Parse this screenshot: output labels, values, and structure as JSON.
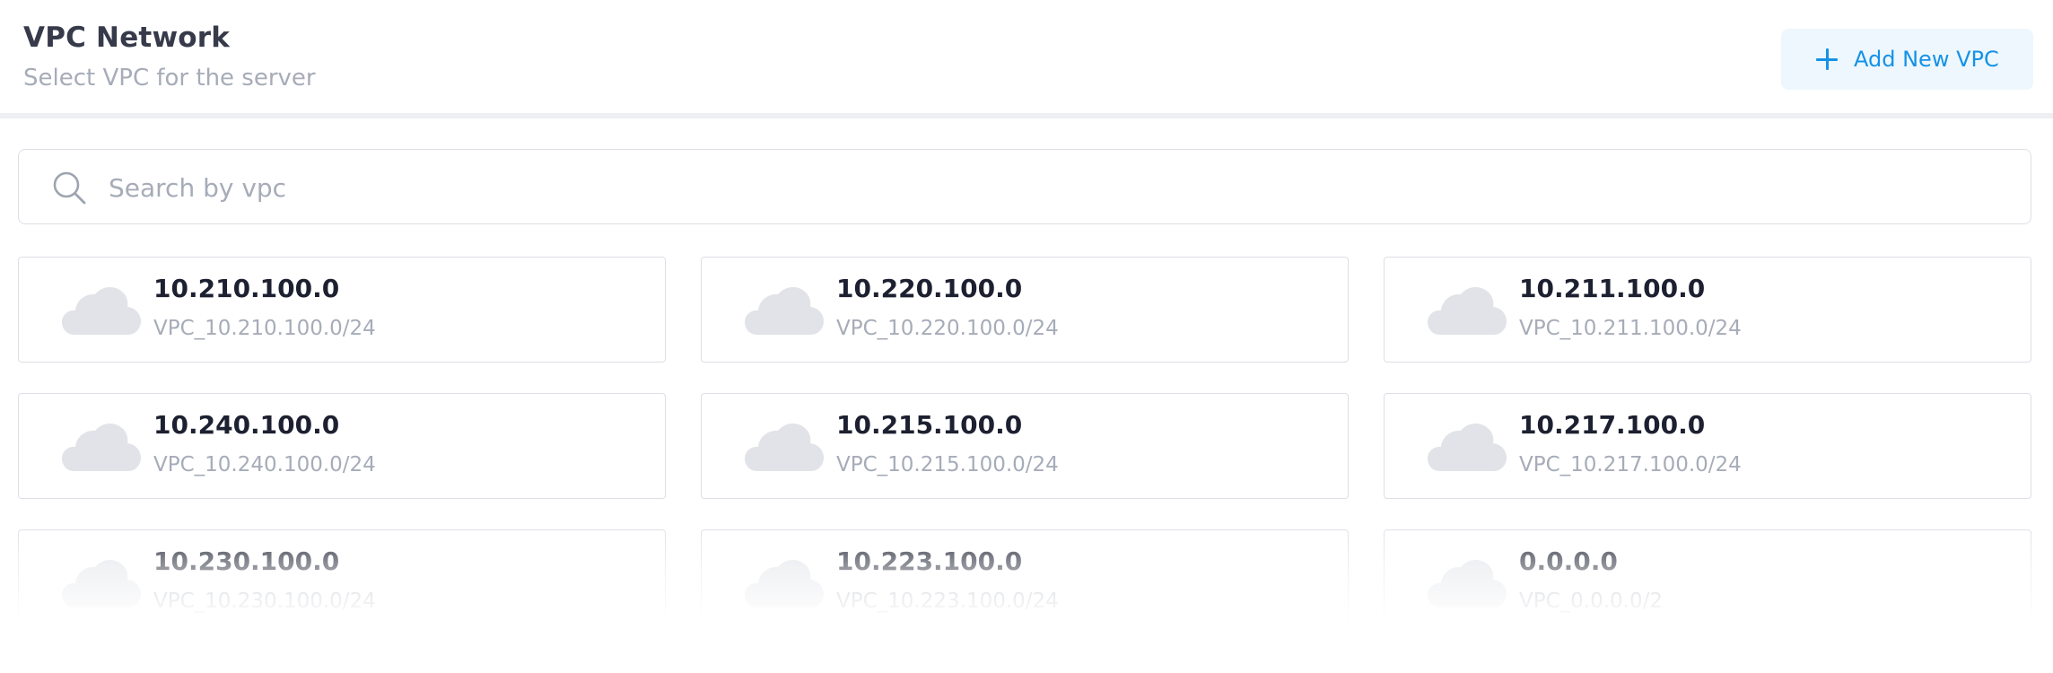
{
  "header": {
    "title": "VPC Network",
    "subtitle": "Select VPC for the server",
    "add_button_label": "Add New VPC"
  },
  "search": {
    "placeholder": "Search by vpc",
    "value": ""
  },
  "icons": {
    "add": "plus-icon",
    "search": "search-icon",
    "vpc": "cloud-icon"
  },
  "colors": {
    "accent": "#1592e6",
    "accent_bg": "#eef7fd",
    "title": "#363a4a",
    "muted": "#a6acb8",
    "border": "#dcdfe5",
    "cloud": "#e1e3e8"
  },
  "vpcs": [
    {
      "cidr": "10.210.100.0",
      "name": "VPC_10.210.100.0/24"
    },
    {
      "cidr": "10.220.100.0",
      "name": "VPC_10.220.100.0/24"
    },
    {
      "cidr": "10.211.100.0",
      "name": "VPC_10.211.100.0/24"
    },
    {
      "cidr": "10.240.100.0",
      "name": "VPC_10.240.100.0/24"
    },
    {
      "cidr": "10.215.100.0",
      "name": "VPC_10.215.100.0/24"
    },
    {
      "cidr": "10.217.100.0",
      "name": "VPC_10.217.100.0/24"
    },
    {
      "cidr": "10.230.100.0",
      "name": "VPC_10.230.100.0/24"
    },
    {
      "cidr": "10.223.100.0",
      "name": "VPC_10.223.100.0/24"
    },
    {
      "cidr": "0.0.0.0",
      "name": "VPC_0.0.0.0/2"
    }
  ]
}
